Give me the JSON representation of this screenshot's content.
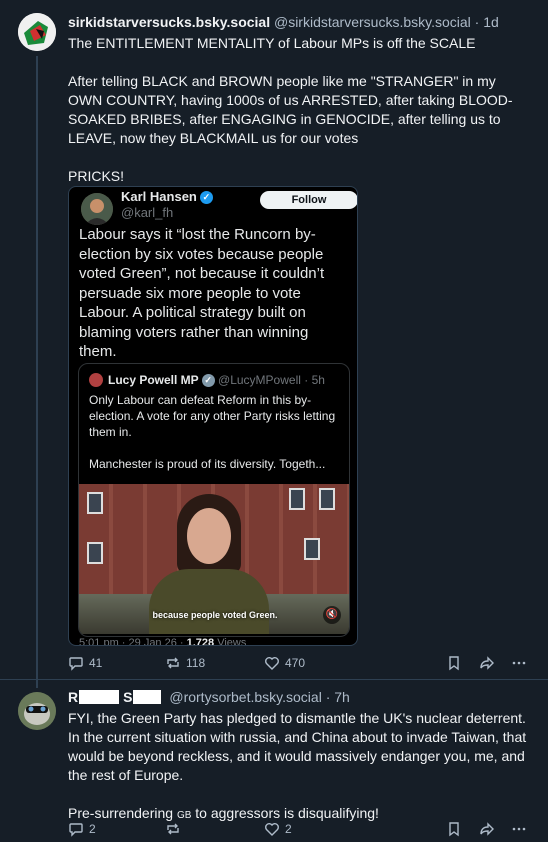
{
  "post1": {
    "display_name": "sirkidstarversucks.bsky.social",
    "handle": "@sirkidstarversucks.bsky.social",
    "time": "· 1d",
    "paragraphs": [
      "The ENTITLEMENT MENTALITY of Labour MPs is off the SCALE",
      "After telling BLACK and BROWN people like me \"STRANGER\" in my OWN COUNTRY, having 1000s of us ARRESTED, after taking BLOOD-SOAKED BRIBES, after ENGAGING in GENOCIDE, after telling us to LEAVE, now they BLACKMAIL us for our votes",
      "PRICKS!"
    ],
    "embed": {
      "name": "Karl Hansen",
      "handle": "@karl_fh",
      "follow_label": "Follow",
      "text": "Labour says it “lost the Runcorn by-election by six votes because people voted Green”, not because it couldn’t persuade six more people to vote Labour. A political strategy built on blaming voters rather than winning them.",
      "quote": {
        "name": "Lucy Powell MP",
        "handle": "@LucyMPowell · 5h",
        "paragraphs": [
          "Only Labour can defeat Reform in this by-election. A vote for any other Party risks letting them in.",
          "Manchester is proud of its diversity. Togeth..."
        ],
        "video_caption": "because people voted Green.",
        "mute_icon": "speaker-muted-icon"
      },
      "meta_time": "5:01 pm · 29 Jan 26 · ",
      "meta_views_count": "1,728",
      "meta_views_label": " Views"
    },
    "actions": {
      "replies": "41",
      "reposts": "118",
      "likes": "470"
    }
  },
  "post2": {
    "display_name_initial1": "R",
    "display_name_initial2": "S",
    "handle": "@rortysorbet.bsky.social",
    "time": "· 7h",
    "paragraphs": [
      "FYI, the Green Party has pledged to dismantle the UK's nuclear deterrent.  In the current situation with russia, and China about to invade Taiwan, that would be beyond reckless, and it would massively endanger you, me, and the rest of Europe."
    ],
    "last_before": "Pre-surrendering ",
    "last_flag": "GB",
    "last_after": " to aggressors is disqualifying!",
    "actions": {
      "replies": "2",
      "reposts": "",
      "likes": "2"
    }
  },
  "colors": {
    "background": "#161e27",
    "text": "#f1f3f5",
    "muted": "#aebbc9",
    "border": "#2e4052",
    "verified": "#1d9bf0"
  }
}
